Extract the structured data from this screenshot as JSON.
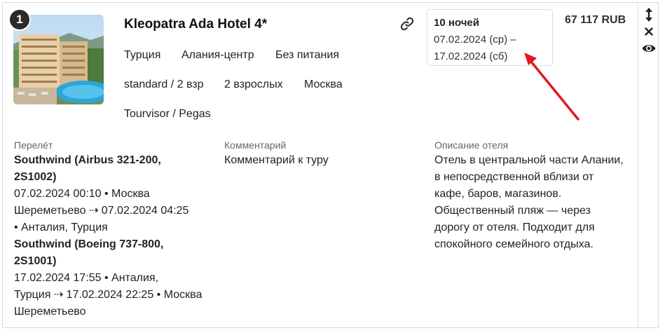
{
  "card": {
    "index": "1",
    "title": "Kleopatra Ada Hotel 4*",
    "tags_row1": [
      "Турция",
      "Алания-центр",
      "Без питания"
    ],
    "tags_row2": [
      "standard / 2 взр",
      "2 взрослых",
      "Москва"
    ],
    "tags_row3": [
      "Tourvisor / Pegas"
    ],
    "dates": {
      "nights": "10 ночей",
      "from": "07.02.2024 (ср) –",
      "to": "17.02.2024 (сб)"
    },
    "price": "67 117 RUB"
  },
  "flight": {
    "label": "Перелёт",
    "segments": [
      {
        "name_line1": "Southwind (Airbus 321-200,",
        "name_line2": "2S1002)",
        "line1": "07.02.2024 00:10 • Москва",
        "line2": "Шереметьево ⇢ 07.02.2024 04:25",
        "line3": "• Анталия, Турция"
      },
      {
        "name_line1": "Southwind (Boeing 737-800,",
        "name_line2": "2S1001)",
        "line1": "17.02.2024 17:55 • Анталия,",
        "line2": "Турция ⇢ 17.02.2024 22:25 • Москва",
        "line3": "Шереметьево"
      }
    ]
  },
  "comment": {
    "label": "Комментарий",
    "text": "Комментарий к туру"
  },
  "description": {
    "label": "Описание отеля",
    "lines": [
      "Отель в центральной части Алании,",
      "в непосредственной вблизи от",
      "кафе, баров, магазинов.",
      "Общественный пляж — через",
      "дорогу от отеля. Подходит для",
      "спокойного семейного отдыха."
    ]
  },
  "side_actions": [
    "move-vertical-icon",
    "close-icon",
    "eye-icon"
  ],
  "colors": {
    "annotation_arrow": "#e0191f",
    "badge": "#2b2b2b",
    "border": "#d9d9d9"
  }
}
